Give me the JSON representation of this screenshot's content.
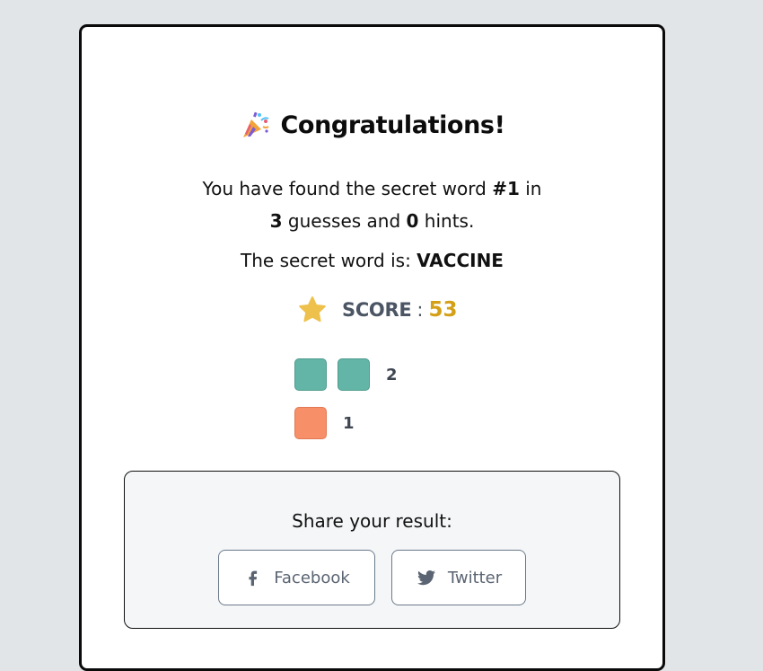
{
  "modal": {
    "title": "Congratulations!",
    "title_icon": "party-popper-icon",
    "message": {
      "prefix": "You have found the secret word ",
      "word_number": "#1",
      "middle": " in",
      "guesses": "3",
      "guesses_text": " guesses and ",
      "hints": "0",
      "hints_text": " hints."
    },
    "secret": {
      "label": "The secret word is: ",
      "word": "VACCINE"
    },
    "score": {
      "icon": "star-icon",
      "label": "SCORE",
      "separator": ":",
      "value": "53",
      "value_color": "#d4a017"
    },
    "results": [
      {
        "color": "green",
        "hex": "#63b6a7",
        "squares": 2,
        "count": "2"
      },
      {
        "color": "orange",
        "hex": "#f79068",
        "squares": 1,
        "count": "1"
      }
    ],
    "share": {
      "title": "Share your result:",
      "facebook": {
        "label": "Facebook",
        "icon": "facebook-icon"
      },
      "twitter": {
        "label": "Twitter",
        "icon": "twitter-icon"
      }
    }
  }
}
